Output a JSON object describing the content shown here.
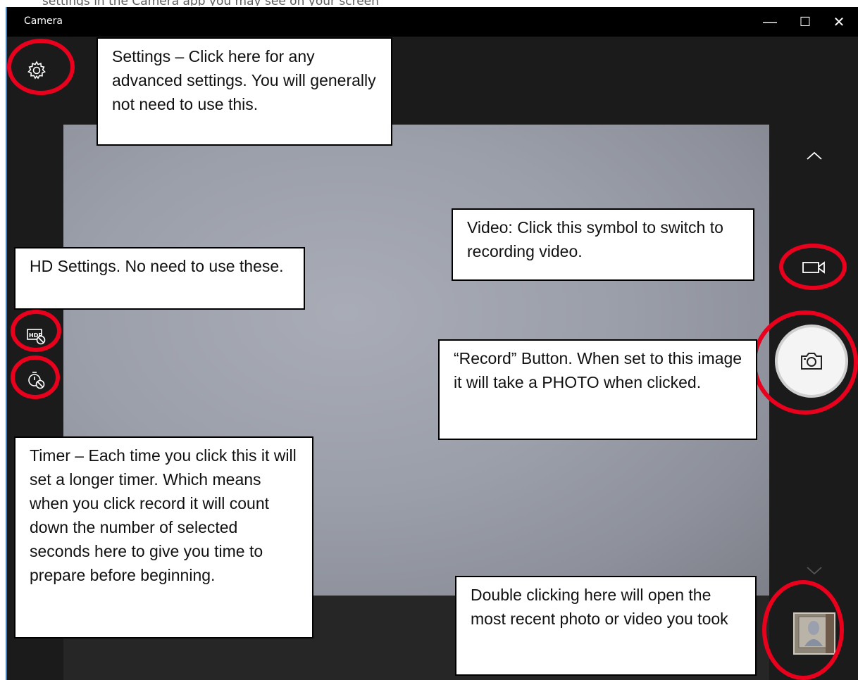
{
  "caption_fragment": "settings in the Camera app you may see on your screen",
  "window": {
    "title": "Camera",
    "minimize_glyph": "—",
    "maximize_glyph": "☐",
    "close_glyph": "✕"
  },
  "icons": {
    "settings": "gear-icon",
    "hdr": "hdr-off-icon",
    "timer": "timer-off-icon",
    "up": "chevron-up-icon",
    "down": "chevron-down-icon",
    "video": "video-camera-icon",
    "photo": "photo-camera-icon",
    "gallery": "recent-photo-thumbnail"
  },
  "callouts": {
    "settings": "Settings – Click here for any advanced settings. You will generally not need to use this.",
    "video": "Video: Click this symbol to switch to recording video.",
    "hd": "HD Settings. No need to use these.",
    "record": "“Record” Button. When set to this image it will take a PHOTO when clicked.",
    "timer": "Timer – Each time you click this it will set a longer timer. Which means when you click record it will count down the number of selected seconds here to give you time to prepare before beginning.",
    "gallery": "Double clicking here will open the most recent photo or video you took"
  },
  "colors": {
    "highlight_ring": "#e8001c",
    "window_border": "#3f7fc0",
    "rail": "#1b1b1b"
  }
}
